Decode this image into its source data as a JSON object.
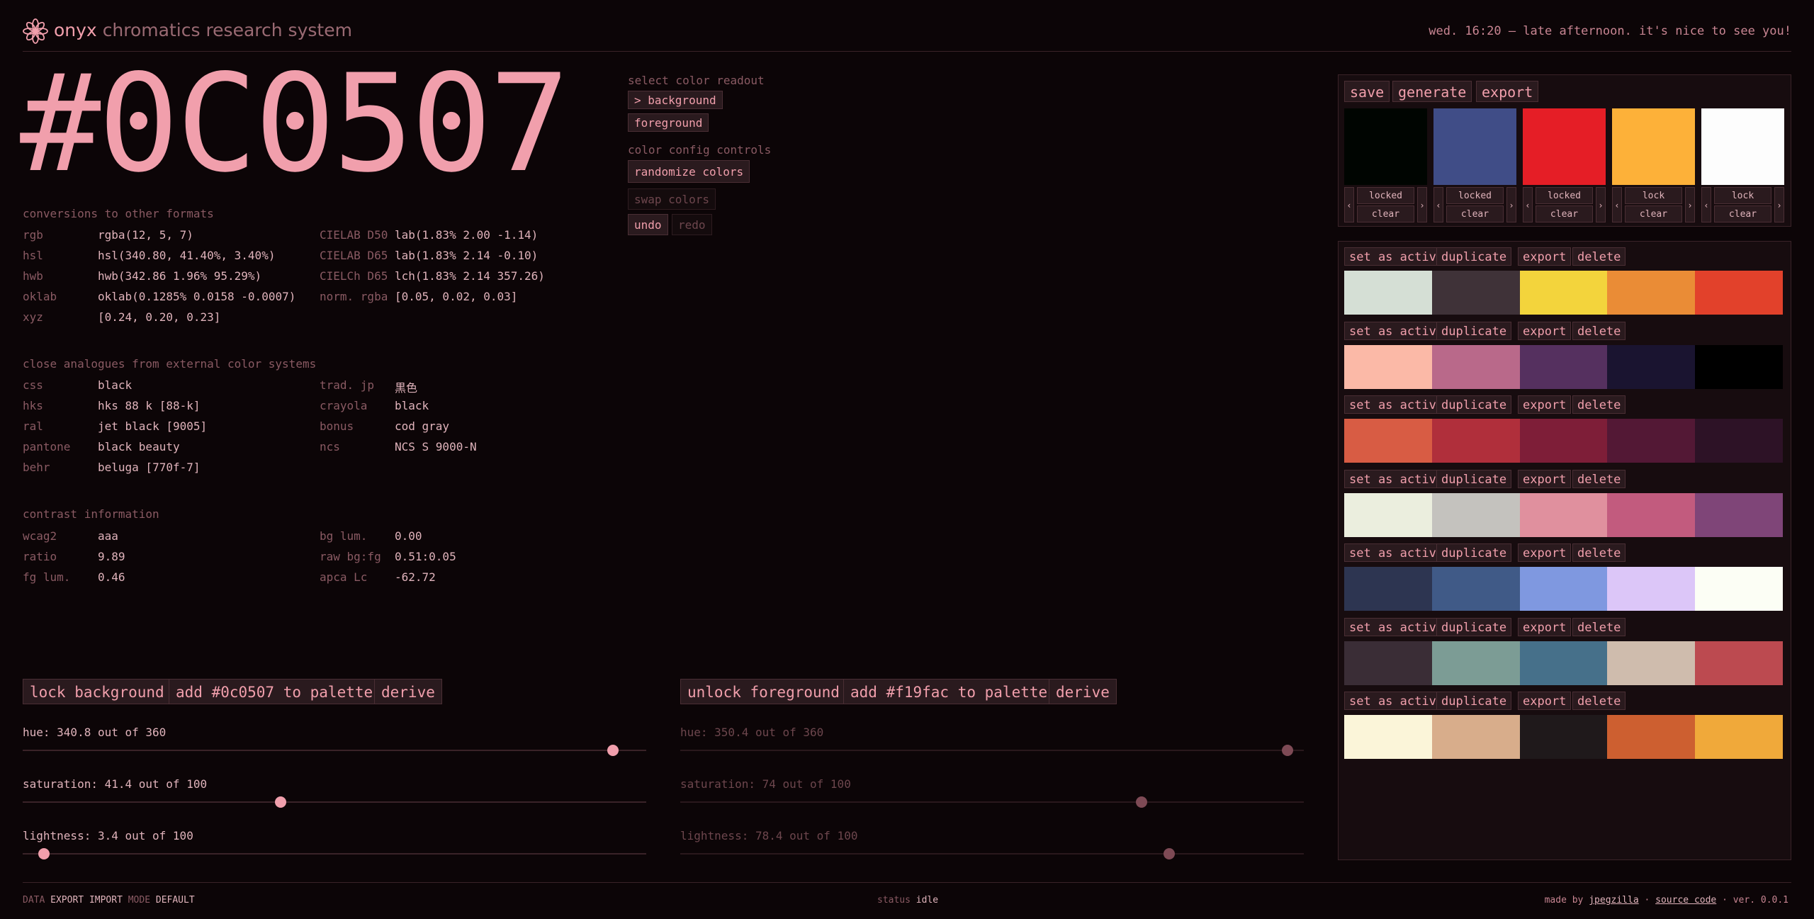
{
  "header": {
    "brand": "onyx",
    "subtitle": "chromatics research system",
    "greeting": "wed. 16:20 — late afternoon. it's nice to see you!"
  },
  "hex": "#0C0507",
  "conversions": {
    "title": "conversions to other formats",
    "left": [
      {
        "k": "rgb",
        "v": "rgba(12, 5, 7)"
      },
      {
        "k": "hsl",
        "v": "hsl(340.80, 41.40%, 3.40%)"
      },
      {
        "k": "hwb",
        "v": "hwb(342.86 1.96% 95.29%)"
      },
      {
        "k": "oklab",
        "v": "oklab(0.1285% 0.0158 -0.0007)"
      },
      {
        "k": "xyz",
        "v": "[0.24, 0.20, 0.23]"
      }
    ],
    "right": [
      {
        "k": "CIELAB D50",
        "v": "lab(1.83% 2.00 -1.14)"
      },
      {
        "k": "CIELAB D65",
        "v": "lab(1.83% 2.14 -0.10)"
      },
      {
        "k": "CIELCh D65",
        "v": "lch(1.83% 2.14 357.26)"
      },
      {
        "k": "norm. rgba",
        "v": "[0.05, 0.02, 0.03]"
      }
    ]
  },
  "analogues": {
    "title": "close analogues from external color systems",
    "left": [
      {
        "k": "css",
        "v": "black"
      },
      {
        "k": "hks",
        "v": "hks 88 k [88-k]"
      },
      {
        "k": "ral",
        "v": "jet black [9005]"
      },
      {
        "k": "pantone",
        "v": "black beauty"
      },
      {
        "k": "behr",
        "v": "beluga [770f-7]"
      }
    ],
    "right": [
      {
        "k": "trad. jp",
        "v": "黒色"
      },
      {
        "k": "crayola",
        "v": "black"
      },
      {
        "k": "bonus",
        "v": "cod gray"
      },
      {
        "k": "ncs",
        "v": "NCS S 9000-N"
      }
    ]
  },
  "contrast": {
    "title": "contrast information",
    "left": [
      {
        "k": "wcag2",
        "v": "aaa"
      },
      {
        "k": "ratio",
        "v": "9.89"
      },
      {
        "k": "fg lum.",
        "v": "0.46"
      }
    ],
    "right": [
      {
        "k": "bg lum.",
        "v": "0.00"
      },
      {
        "k": "raw bg:fg",
        "v": "0.51:0.05"
      },
      {
        "k": "apca Lc",
        "v": "-62.72"
      }
    ]
  },
  "controls": {
    "readout_label": "select color readout",
    "background_btn": "> background",
    "foreground_btn": "foreground",
    "config_label": "color config controls",
    "randomize": "randomize colors",
    "swap": "swap colors",
    "undo": "undo",
    "redo": "redo"
  },
  "bg_actions": {
    "lock": "lock background",
    "add": "add #0c0507 to palette",
    "derive": "derive"
  },
  "fg_actions": {
    "lock": "unlock foreground",
    "add": "add #f19fac to palette",
    "derive": "derive"
  },
  "bg_sliders": [
    {
      "label": "hue: 340.8 out of 360",
      "value": 340.8,
      "max": 360
    },
    {
      "label": "saturation: 41.4 out of 100",
      "value": 41.4,
      "max": 100
    },
    {
      "label": "lightness: 3.4 out of 100",
      "value": 3.4,
      "max": 100
    }
  ],
  "fg_sliders": [
    {
      "label": "hue: 350.4 out of 360",
      "value": 350.4,
      "max": 360
    },
    {
      "label": "saturation: 74 out of 100",
      "value": 74,
      "max": 100
    },
    {
      "label": "lightness: 78.4 out of 100",
      "value": 78.4,
      "max": 100
    }
  ],
  "panel": {
    "save": "save",
    "generate": "generate",
    "export": "export",
    "swatches": [
      {
        "color": "#000501",
        "state": "locked",
        "clear": "clear"
      },
      {
        "color": "#404d87",
        "state": "locked",
        "clear": "clear"
      },
      {
        "color": "#e51e26",
        "state": "locked",
        "clear": "clear"
      },
      {
        "color": "#fdb139",
        "state": "lock",
        "clear": "clear"
      },
      {
        "color": "#fdfdfd",
        "state": "lock",
        "clear": "clear"
      }
    ]
  },
  "saved": {
    "set_active": "set as active",
    "duplicate": "duplicate",
    "export": "export",
    "delete": "delete",
    "palettes": [
      [
        "#d5dfd5",
        "#3f3238",
        "#f3d43c",
        "#ea8c36",
        "#e2412b"
      ],
      [
        "#fbb9a7",
        "#b9698a",
        "#55305f",
        "#1a1430",
        "#000000"
      ],
      [
        "#d85c44",
        "#b02f3b",
        "#7e1e38",
        "#531835",
        "#2d1226"
      ],
      [
        "#ebeede",
        "#c4c2be",
        "#e0909e",
        "#c25b7e",
        "#7f4578"
      ],
      [
        "#2d3551",
        "#405a87",
        "#7f98e0",
        "#dcc6f8",
        "#fcfef5"
      ],
      [
        "#3a2d36",
        "#7c9c95",
        "#46708a",
        "#cfbcad",
        "#bc4a50"
      ],
      [
        "#fbf5d9",
        "#d8ad8b",
        "#1f191b",
        "#cd5f30",
        "#f0a93a"
      ]
    ]
  },
  "footer": {
    "data": "DATA",
    "export": "EXPORT",
    "import": "IMPORT",
    "mode": "MODE",
    "default": "DEFAULT",
    "status_label": "status",
    "status_value": "idle",
    "made_by": "made by",
    "author": "jpegzilla",
    "source": "source code",
    "version": "· ver. 0.0.1"
  },
  "colors": {
    "bg": "#0c0507",
    "fg": "#f19fac",
    "bg_thumb": "#f19fac",
    "fg_thumb": "#7e4a55"
  }
}
